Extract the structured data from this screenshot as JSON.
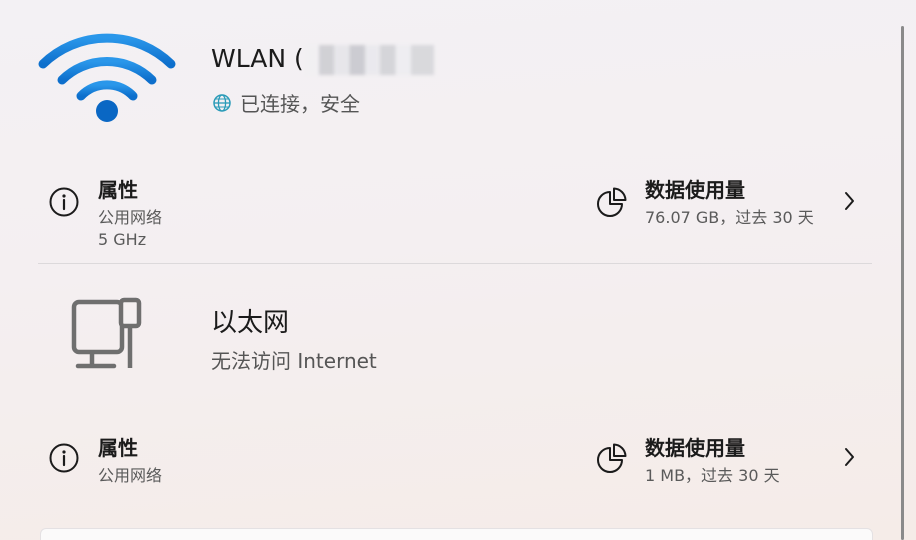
{
  "wlan": {
    "name": "WLAN (",
    "status_icon": "globe-icon",
    "status": "已连接，安全",
    "properties": {
      "icon": "info-icon",
      "title": "属性",
      "network_type": "公用网络",
      "band": "5 GHz"
    },
    "data_usage": {
      "icon": "pie-chart-icon",
      "title": "数据使用量",
      "value": "76.07 GB，过去 30 天"
    }
  },
  "ethernet": {
    "icon": "ethernet-computer-icon",
    "name": "以太网",
    "status": "无法访问 Internet",
    "properties": {
      "icon": "info-icon",
      "title": "属性",
      "network_type": "公用网络"
    },
    "data_usage": {
      "icon": "pie-chart-icon",
      "title": "数据使用量",
      "value": "1 MB，过去 30 天"
    }
  },
  "colors": {
    "wifi_accent": "#0067c0",
    "wifi_light": "#2b8fe6",
    "globe": "#2a9bb8"
  }
}
